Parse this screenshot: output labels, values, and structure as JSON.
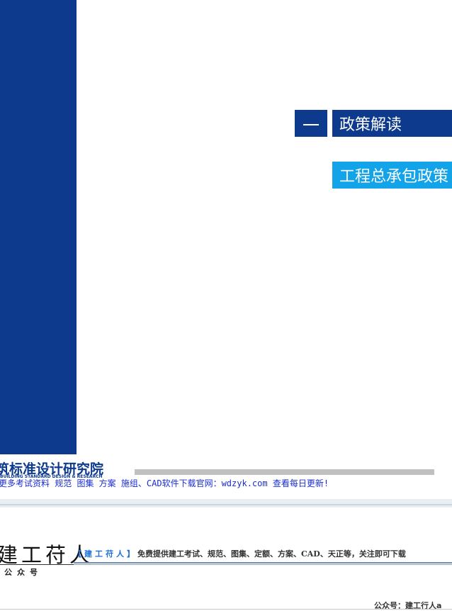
{
  "slide": {
    "section_number": "一",
    "section_title": "政策解读",
    "subtitle": "工程总承包政策"
  },
  "footer": {
    "institute_name": "筑标准设计研究院",
    "institute_en": "BUILDING STANDARD DESIGN & RESEARCH",
    "download_note": "更多考试资料 规范 图集 方案 施组、CAD软件下载官网：wdzyk.com 查看每日更新!",
    "brand_name": "建工苻人",
    "brand_sub": "公众号",
    "banner_tag": "【建工苻人】",
    "banner_text": "免费提供建工考试、规范、图集、定额、方案、CAD、天正等，关注即可下载",
    "account_label": "公众号：建工行人a"
  },
  "colors": {
    "navy": "#0d3a8c",
    "cyan": "#13a3e8",
    "link_blue": "#1a2dd4"
  }
}
